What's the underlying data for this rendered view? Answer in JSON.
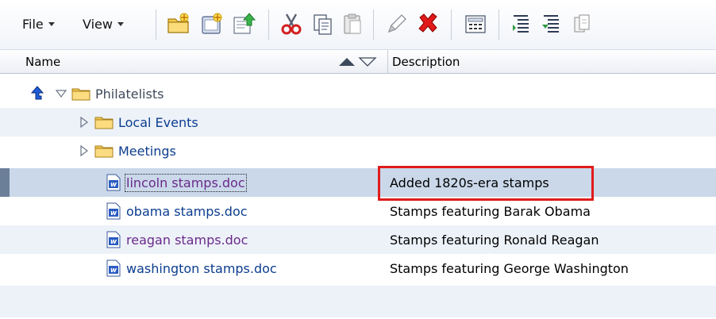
{
  "toolbar": {
    "menus": [
      {
        "label": "File"
      },
      {
        "label": "View"
      }
    ],
    "buttons": [
      {
        "name": "new-folder-icon"
      },
      {
        "name": "new-document-icon"
      },
      {
        "name": "upload-icon"
      },
      {
        "name": "cut-icon"
      },
      {
        "name": "copy-icon"
      },
      {
        "name": "paste-icon"
      },
      {
        "name": "edit-pencil-icon"
      },
      {
        "name": "delete-icon"
      },
      {
        "name": "calculator-icon"
      },
      {
        "name": "expand-all-icon"
      },
      {
        "name": "collapse-all-icon"
      },
      {
        "name": "detach-icon"
      }
    ]
  },
  "columns": {
    "name": "Name",
    "description": "Description"
  },
  "tree": {
    "root": {
      "label": "Philatelists"
    },
    "folders": [
      {
        "label": "Local Events"
      },
      {
        "label": "Meetings"
      }
    ],
    "documents": [
      {
        "label": "lincoln stamps.doc",
        "description": "Added 1820s-era stamps",
        "selected": true
      },
      {
        "label": "obama stamps.doc",
        "description": "Stamps featuring Barak Obama"
      },
      {
        "label": "reagan stamps.doc",
        "description": "Stamps featuring Ronald Reagan"
      },
      {
        "label": "washington stamps.doc",
        "description": "Stamps featuring George Washington"
      }
    ]
  },
  "colors": {
    "selection": "#cad8ea",
    "alt_row": "#edf2f9",
    "highlight_box": "#e01b1b",
    "link": "#0b3d8f",
    "visited_link": "#6a2a8a"
  }
}
